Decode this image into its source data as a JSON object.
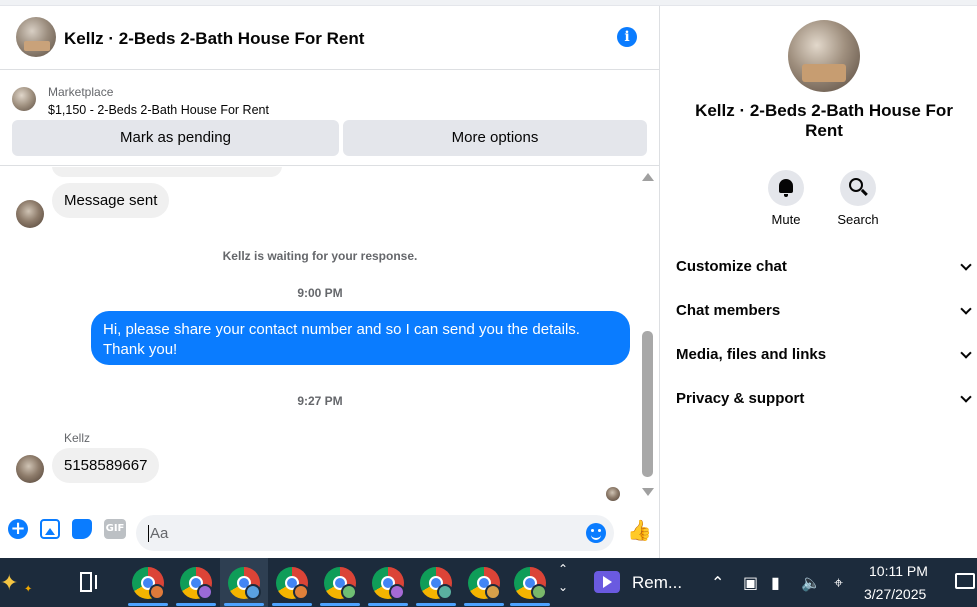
{
  "chat": {
    "title": "Kellz · 2-Beds 2-Bath House For Rent",
    "marketplace": {
      "label": "Marketplace",
      "item": "$1,150 - 2-Beds 2-Bath House For Rent",
      "mark_pending": "Mark as pending",
      "more_options": "More options"
    },
    "messages": {
      "sent_notice": "Message sent",
      "waiting": "Kellz is waiting for your response.",
      "time1": "9:00 PM",
      "outgoing": "Hi, please share your contact number and so I can send you the details. Thank you!",
      "time2": "9:27 PM",
      "sender": "Kellz",
      "incoming": "5158589667"
    },
    "composer": {
      "placeholder": "Aa",
      "gif_label": "GIF"
    }
  },
  "side": {
    "title": "Kellz · 2-Beds 2-Bath House For Rent",
    "actions": {
      "mute": "Mute",
      "search": "Search"
    },
    "menu": [
      {
        "label": "Customize chat"
      },
      {
        "label": "Chat members"
      },
      {
        "label": "Media, files and links"
      },
      {
        "label": "Privacy & support"
      }
    ]
  },
  "taskbar": {
    "app_label": "Rem...",
    "time": "10:11 PM",
    "date": "3/27/2025"
  },
  "colors": {
    "accent": "#0a7cff",
    "taskbar": "#1c2b3c"
  }
}
